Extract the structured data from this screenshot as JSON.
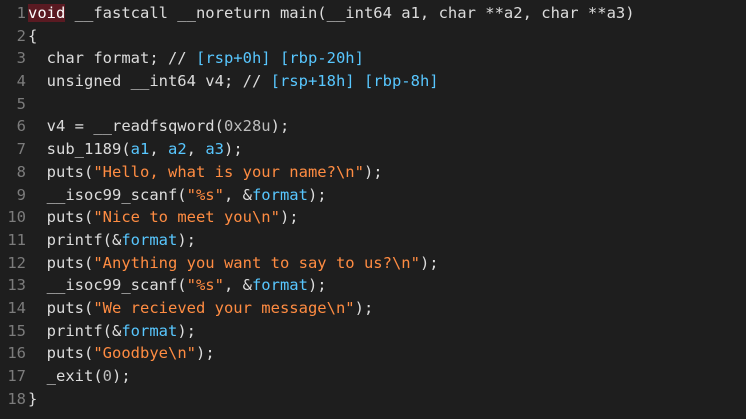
{
  "editor": {
    "lines": [
      {
        "num": "1",
        "tokens": [
          {
            "t": "void",
            "c": "hl"
          },
          {
            "t": " __fastcall __noreturn main(__int64 a1, char **a2, char **a3)",
            "c": "name"
          }
        ]
      },
      {
        "num": "2",
        "tokens": [
          {
            "t": "{",
            "c": "punct"
          }
        ]
      },
      {
        "num": "3",
        "tokens": [
          {
            "t": "  char format; // ",
            "c": "name"
          },
          {
            "t": "[rsp+0h] [rbp-20h]",
            "c": "reg"
          }
        ]
      },
      {
        "num": "4",
        "tokens": [
          {
            "t": "  unsigned __int64 v4; // ",
            "c": "name"
          },
          {
            "t": "[rsp+18h] [rbp-8h]",
            "c": "reg"
          }
        ]
      },
      {
        "num": "5",
        "tokens": [
          {
            "t": "",
            "c": "ws"
          }
        ]
      },
      {
        "num": "6",
        "tokens": [
          {
            "t": "  v4 = __readfsqword(",
            "c": "name"
          },
          {
            "t": "0x28u",
            "c": "num"
          },
          {
            "t": ");",
            "c": "punct"
          }
        ]
      },
      {
        "num": "7",
        "tokens": [
          {
            "t": "  sub_1189(",
            "c": "name"
          },
          {
            "t": "a1",
            "c": "var"
          },
          {
            "t": ", ",
            "c": "punct"
          },
          {
            "t": "a2",
            "c": "var"
          },
          {
            "t": ", ",
            "c": "punct"
          },
          {
            "t": "a3",
            "c": "var"
          },
          {
            "t": ");",
            "c": "punct"
          }
        ]
      },
      {
        "num": "8",
        "tokens": [
          {
            "t": "  puts(",
            "c": "name"
          },
          {
            "t": "\"Hello, what is your name?\\n\"",
            "c": "str"
          },
          {
            "t": ");",
            "c": "punct"
          }
        ]
      },
      {
        "num": "9",
        "tokens": [
          {
            "t": "  __isoc99_scanf(",
            "c": "name"
          },
          {
            "t": "\"%s\"",
            "c": "str"
          },
          {
            "t": ", &",
            "c": "punct"
          },
          {
            "t": "format",
            "c": "var"
          },
          {
            "t": ");",
            "c": "punct"
          }
        ]
      },
      {
        "num": "10",
        "tokens": [
          {
            "t": "  puts(",
            "c": "name"
          },
          {
            "t": "\"Nice to meet you\\n\"",
            "c": "str"
          },
          {
            "t": ");",
            "c": "punct"
          }
        ]
      },
      {
        "num": "11",
        "tokens": [
          {
            "t": "  printf(&",
            "c": "name"
          },
          {
            "t": "format",
            "c": "var"
          },
          {
            "t": ");",
            "c": "punct"
          }
        ]
      },
      {
        "num": "12",
        "tokens": [
          {
            "t": "  puts(",
            "c": "name"
          },
          {
            "t": "\"Anything you want to say to us?\\n\"",
            "c": "str"
          },
          {
            "t": ");",
            "c": "punct"
          }
        ]
      },
      {
        "num": "13",
        "tokens": [
          {
            "t": "  __isoc99_scanf(",
            "c": "name"
          },
          {
            "t": "\"%s\"",
            "c": "str"
          },
          {
            "t": ", &",
            "c": "punct"
          },
          {
            "t": "format",
            "c": "var"
          },
          {
            "t": ");",
            "c": "punct"
          }
        ]
      },
      {
        "num": "14",
        "tokens": [
          {
            "t": "  puts(",
            "c": "name"
          },
          {
            "t": "\"We recieved your message\\n\"",
            "c": "str"
          },
          {
            "t": ");",
            "c": "punct"
          }
        ]
      },
      {
        "num": "15",
        "tokens": [
          {
            "t": "  printf(&",
            "c": "name"
          },
          {
            "t": "format",
            "c": "var"
          },
          {
            "t": ");",
            "c": "punct"
          }
        ]
      },
      {
        "num": "16",
        "tokens": [
          {
            "t": "  puts(",
            "c": "name"
          },
          {
            "t": "\"Goodbye\\n\"",
            "c": "str"
          },
          {
            "t": ");",
            "c": "punct"
          }
        ]
      },
      {
        "num": "17",
        "tokens": [
          {
            "t": "  _exit(",
            "c": "name"
          },
          {
            "t": "0",
            "c": "num"
          },
          {
            "t": ");",
            "c": "punct"
          }
        ]
      },
      {
        "num": "18",
        "tokens": [
          {
            "t": "}",
            "c": "punct"
          }
        ]
      }
    ]
  },
  "colors": {
    "background": "#1e1e1e",
    "text": "#dcdcdc",
    "string": "#ff8c42",
    "variable": "#58c7ff",
    "line_number": "#7c7c7c",
    "keyword_highlight": "#5a1a22"
  }
}
